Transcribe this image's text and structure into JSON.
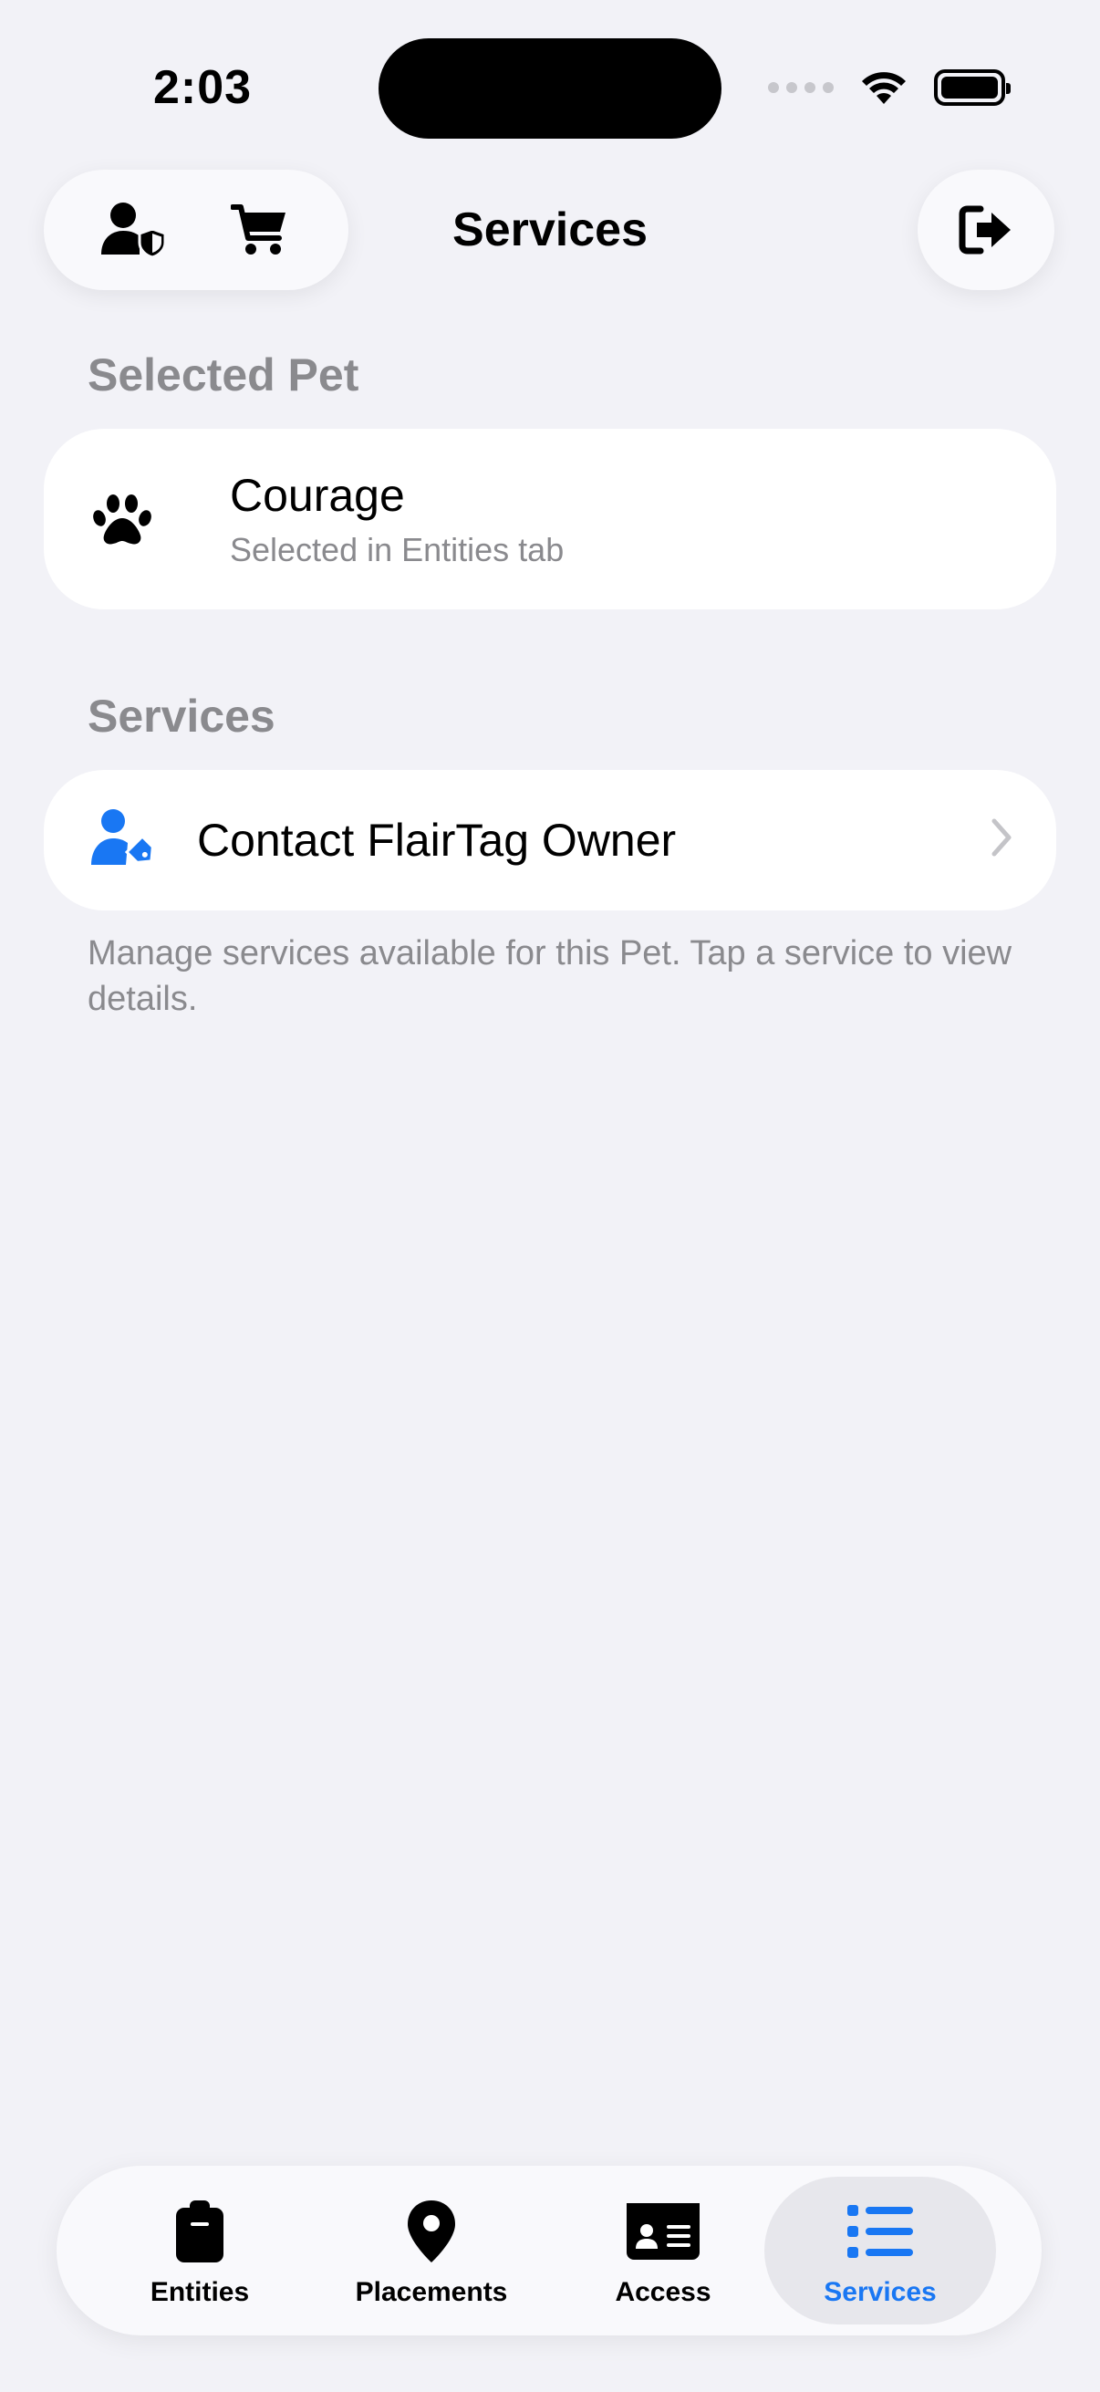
{
  "status_bar": {
    "time": "2:03"
  },
  "nav": {
    "title": "Services"
  },
  "selected_pet": {
    "header": "Selected Pet",
    "name": "Courage",
    "subtitle": "Selected in Entities tab"
  },
  "services": {
    "header": "Services",
    "items": [
      {
        "label": "Contact FlairTag Owner",
        "icon": "person-tag-icon"
      }
    ],
    "footer": "Manage services available for this Pet. Tap a service to view details."
  },
  "tabs": [
    {
      "label": "Entities",
      "icon": "clipboard-icon",
      "active": false
    },
    {
      "label": "Placements",
      "icon": "map-pin-icon",
      "active": false
    },
    {
      "label": "Access",
      "icon": "id-card-icon",
      "active": false
    },
    {
      "label": "Services",
      "icon": "list-icon",
      "active": true
    }
  ],
  "colors": {
    "accent": "#1977f3",
    "background": "#f2f2f7",
    "secondary_text": "#8a8a8e"
  }
}
